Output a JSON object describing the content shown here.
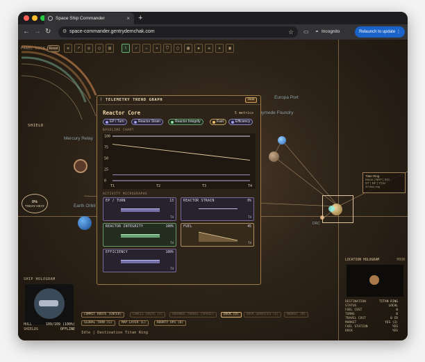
{
  "browser": {
    "tab_title": "Space Ship Commander",
    "url": "space-commander.gentrydemchak.com",
    "incognito_label": "Incognito",
    "relaunch_label": "Relaunch to update",
    "colors": {
      "traffic_red": "#fe5f57",
      "traffic_yellow": "#febc2e",
      "traffic_green": "#28c840",
      "relaunch": "#1b63c9"
    }
  },
  "dock": {
    "label": "PANEL DOCK",
    "reset_label": "Reset",
    "icons": [
      "wrench-icon",
      "cursor-icon",
      "target-icon",
      "ring-icon",
      "book-icon",
      "trend-icon",
      "rocket-icon",
      "flame-icon",
      "cross-icon",
      "shield-icon",
      "box-icon",
      "grid-icon",
      "cube-icon",
      "layers-icon",
      "gear-icon",
      "panel-icon"
    ],
    "active_icon": "trend-icon"
  },
  "map": {
    "labels": {
      "europa_port": "Europa Port",
      "ganymede_foundry": "Ganymede Foundry",
      "mercury_relay": "Mercury Relay",
      "earth_orbit": "Earth Orbit",
      "drc": "DRC"
    },
    "shields_arc_label": "SHIELD",
    "gauge": {
      "value": "0%",
      "label": "TODAY HEAT"
    }
  },
  "titan_card": {
    "name": "Titan Ring",
    "line1": "Moon | NRT | SrC",
    "line2": "DT | DF | YOU",
    "line3": "30 titan ring"
  },
  "telemetry": {
    "title": "TELEMETRY TREND GRAPH",
    "hide_label": "Hide",
    "subject": "Reactor Core",
    "metrics_count": "5 metrics",
    "chips": [
      {
        "label": "EP / Turn",
        "tone": "violet"
      },
      {
        "label": "Reactor Strain",
        "tone": "violet"
      },
      {
        "label": "Reactor Integrity",
        "tone": "green"
      },
      {
        "label": "Fuel",
        "tone": "amber"
      },
      {
        "label": "Efficiency",
        "tone": "violet"
      }
    ],
    "baseline_label": "BASELINE CHART",
    "micro_label": "ACTIVITY MICROGRAPHS",
    "cards": [
      {
        "title": "EP / TURN",
        "value": "13",
        "turn": "T4",
        "tone": "violet",
        "level": 0.5
      },
      {
        "title": "REACTOR STRAIN",
        "value": "0%",
        "turn": "T4",
        "tone": "violet",
        "level": 0.5
      },
      {
        "title": "REACTOR INTEGRITY",
        "value": "100%",
        "turn": "T4",
        "tone": "green",
        "level": 0.5
      },
      {
        "title": "FUEL",
        "value": "45",
        "turn": "T4",
        "tone": "amber",
        "level": 0.5
      },
      {
        "title": "EFFICIENCY",
        "value": "100%",
        "turn": "T4",
        "tone": "violet",
        "level": 0.5
      }
    ]
  },
  "chart_data": {
    "type": "line",
    "x": [
      "T1",
      "T2",
      "T3",
      "T4"
    ],
    "yticks": [
      0,
      25,
      50,
      75,
      100
    ],
    "ylim": [
      0,
      100
    ],
    "series": [
      {
        "values": [
          100,
          100,
          100,
          100
        ],
        "color": "#d8d8f0"
      },
      {
        "values": [
          82,
          70,
          58,
          46
        ],
        "color": "#e8d0a0"
      },
      {
        "values": [
          13,
          13,
          13,
          13
        ],
        "color": "#a8a4e0"
      },
      {
        "values": [
          0,
          0,
          0,
          0
        ],
        "color": "#b0acd8"
      }
    ],
    "grid": false
  },
  "ship": {
    "holo_label": "SHIP HOLOGRAM",
    "hull_label": "HULL",
    "hull_value": "109/109 (100%)",
    "shields_label": "SHIELDS",
    "shields_value": "OFFLINE"
  },
  "commands": {
    "buttons": [
      {
        "label": "COMMIT ROUTE (ENTER)",
        "state": "normal"
      },
      {
        "label": "CANCEL ROUTE (X)",
        "state": "dim"
      },
      {
        "label": "ADVANCE TRAVEL (SPACE)",
        "state": "dim"
      },
      {
        "label": "DOCK (D)",
        "state": "hi"
      },
      {
        "label": "DOCK SERVICES (S)",
        "state": "dim"
      },
      {
        "label": "MARKET (M)",
        "state": "dim"
      },
      {
        "label": "GLOBAL TURN (G)",
        "state": "normal"
      },
      {
        "label": "MAP LAYER (L)",
        "state": "normal"
      },
      {
        "label": "BOUNTY OPS (B)",
        "state": "normal"
      }
    ],
    "status": "Idle | Destination Titan Ring"
  },
  "location": {
    "title": "LOCATION HOLOGRAM",
    "kind": "MOON",
    "rows": [
      {
        "k": "DESTINATION",
        "v": "TITAN RING"
      },
      {
        "k": "STATUS",
        "v": "LOCAL"
      },
      {
        "k": "FUEL COST",
        "v": "0"
      },
      {
        "k": "TURNS",
        "v": "0"
      },
      {
        "k": "TRAVEL COST",
        "v": "0 CR"
      },
      {
        "k": "MARKET",
        "v": "YES (2)"
      },
      {
        "k": "FUEL STATION",
        "v": "YES"
      },
      {
        "k": "DOCK",
        "v": "YES"
      }
    ]
  }
}
